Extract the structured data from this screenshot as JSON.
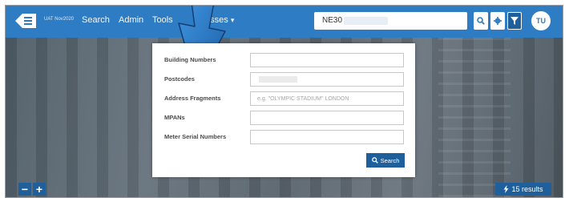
{
  "navbar": {
    "env_label": "UAT Nov2020",
    "links": [
      "Search",
      "Admin",
      "Tools"
    ],
    "dropdown_label": "esses",
    "dropdown_caret": "▾",
    "search_value": "NE30",
    "avatar_initials": "TU"
  },
  "modal": {
    "fields": {
      "building_numbers": {
        "label": "Building Numbers",
        "placeholder": ""
      },
      "postcodes": {
        "label": "Postcodes",
        "placeholder": ""
      },
      "address_fragments": {
        "label": "Address Fragments",
        "placeholder": "e.g. \"OLYMPIC STADIUM\" LONDON"
      },
      "mpans": {
        "label": "MPANs",
        "placeholder": ""
      },
      "meter_serial_numbers": {
        "label": "Meter Serial Numbers",
        "placeholder": ""
      }
    },
    "search_button": "Search"
  },
  "map_controls": {
    "zoom_out": "−",
    "zoom_in": "+",
    "results_label": "15 results"
  },
  "colors": {
    "navbar": "#2e7cc4",
    "primary_button": "#1f5f9c"
  },
  "icons": {
    "logo": "hamburger-logo-icon",
    "search": "search-icon",
    "settings": "gear-icon",
    "filter": "filter-icon",
    "results": "lightning-icon",
    "pointer": "pointer-arrow-icon"
  }
}
